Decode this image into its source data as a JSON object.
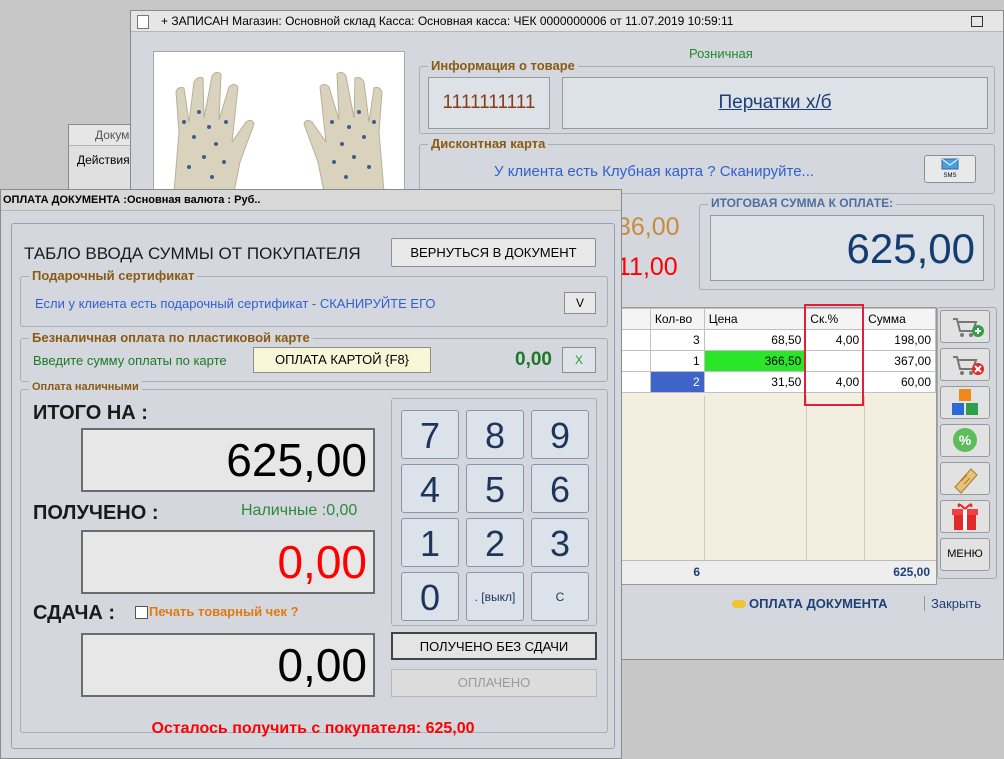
{
  "colors": {
    "brand_red": "#ff0000",
    "accent_blue": "#1e3f75",
    "green_cell": "#29e629",
    "selected_cell": "#3f64c9",
    "orange": "#d88a1a"
  },
  "back_window": {
    "title": "Докум",
    "menu": "Действия"
  },
  "main_window": {
    "title": "+ ЗАПИСАН Магазин: Основной склад Касса: Основная касса: ЧЕК 0000000006 от 11.07.2019 10:59:11",
    "price_type": "Розничная",
    "product_info_legend": "Информация о товаре",
    "barcode": "1111111111",
    "product_name": "Перчатки х/б",
    "discount_legend": "Дисконтная карта",
    "discount_prompt": "У клиента есть Клубная карта ? Сканируйте...",
    "sms_label": "SMS",
    "partial_amount_1": "36,00",
    "partial_amount_2": "11,00",
    "total_legend": "ИТОГОВАЯ СУММА К ОПЛАТЕ:",
    "total_value": "625,00",
    "table": {
      "headers": [
        "Кол-во",
        "Цена",
        "Ск.%",
        "Сумма"
      ],
      "rows": [
        {
          "qty": "3",
          "price": "68,50",
          "disc": "4,00",
          "sum": "198,00"
        },
        {
          "qty": "1",
          "price": "366,50",
          "disc": "",
          "sum": "367,00"
        },
        {
          "qty": "2",
          "price": "31,50",
          "disc": "4,00",
          "sum": "60,00"
        }
      ],
      "footer_qty": "6",
      "footer_sum": "625,00"
    },
    "menu_button": "МЕНЮ",
    "pay_link": "ОПЛАТА ДОКУМЕНТА",
    "close_link": "Закрыть"
  },
  "payment": {
    "title": "ОПЛАТА ДОКУМЕНТА :Основная валюта : Руб..",
    "heading": "ТАБЛО ВВОДА СУММЫ ОТ ПОКУПАТЕЛЯ",
    "back_button": "ВЕРНУТЬСЯ В ДОКУМЕНТ",
    "gift_legend": "Подарочный сертификат",
    "gift_prompt": "Если у клиента есть подарочный сертификат - СКАНИРУЙТЕ ЕГО",
    "gift_button": "V",
    "card_legend": "Безналичная оплата по пластиковой карте",
    "card_prompt": "Введите сумму оплаты по карте",
    "card_button": "ОПЛАТА КАРТОЙ  {F8}",
    "card_amount": "0,00",
    "card_clear": "X",
    "cash_legend": "Оплата наличными",
    "total_label": "ИТОГО НА :",
    "total_value": "625,00",
    "received_label": "ПОЛУЧЕНО :",
    "cash_info": "Наличные :0,00",
    "received_value": "0,00",
    "change_label": "СДАЧА :",
    "print_check_label": "Печать товарный чек ?",
    "change_value": "0,00",
    "keys": [
      "7",
      "8",
      "9",
      "4",
      "5",
      "6",
      "1",
      "2",
      "3",
      "0",
      ". [выкл]",
      "C [backsp]"
    ],
    "no_change_button": "ПОЛУЧЕНО БЕЗ СДАЧИ",
    "paid_button": "ОПЛАЧЕНО",
    "remaining": "Осталось получить с покупателя: 625,00"
  }
}
